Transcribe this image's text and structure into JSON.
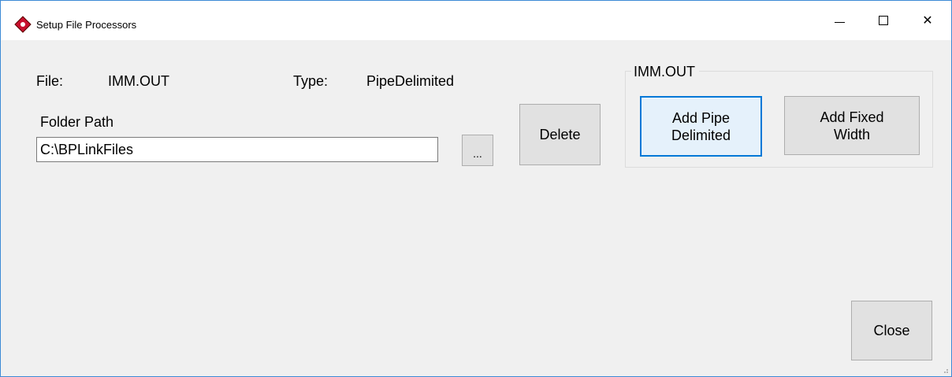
{
  "window": {
    "title": "Setup File Processors",
    "controls": {
      "minimize_icon": "minimize-icon",
      "maximize_icon": "maximize-icon",
      "close_icon": "close-icon",
      "close_glyph": "✕"
    }
  },
  "file": {
    "label": "File:",
    "value": "IMM.OUT"
  },
  "type": {
    "label": "Type:",
    "value": "PipeDelimited"
  },
  "folder": {
    "label": "Folder Path",
    "value": "C:\\BPLinkFiles",
    "browse_label": "..."
  },
  "actions": {
    "delete_label": "Delete",
    "close_label": "Close"
  },
  "group": {
    "title": "IMM.OUT",
    "add_pipe_line1": "Add Pipe",
    "add_pipe_line2": "Delimited",
    "add_fixed_line1": "Add Fixed",
    "add_fixed_line2": "Width"
  },
  "colors": {
    "accent": "#0078d7",
    "window_border": "#3c8ad6",
    "background": "#f0f0f0",
    "icon_red": "#c8102e"
  }
}
